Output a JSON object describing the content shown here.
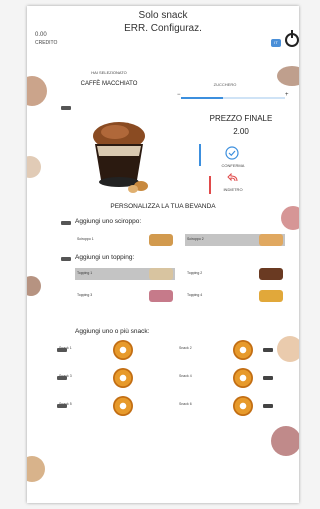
{
  "header": {
    "credit_value": "0.00",
    "credit_label": "CREDITO",
    "title_line1": "Solo snack",
    "title_line2": "ERR. Configuraz.",
    "lang_button": "IT"
  },
  "selection": {
    "label": "HAI SELEZIONATO",
    "product": "CAFFÈ MACCHIATO"
  },
  "sugar": {
    "label": "ZUCCHERO",
    "level": 0.4
  },
  "price": {
    "label": "PREZZO FINALE",
    "value": "2.00"
  },
  "actions": {
    "confirm_label": "CONFERMA",
    "back_label": "INDIETRO"
  },
  "personalize": {
    "title": "PERSONALIZZA LA TUA BEVANDA",
    "syrup_title": "Aggiungi uno sciroppo:",
    "syrups": [
      {
        "label": "Sciroppo 1",
        "selected": false
      },
      {
        "label": "Sciroppo 2",
        "selected": true
      }
    ],
    "topping_title": "Aggiungi un topping:",
    "toppings": [
      {
        "label": "Topping 1",
        "selected": true
      },
      {
        "label": "Topping 2",
        "selected": false
      },
      {
        "label": "Topping 3",
        "selected": false
      },
      {
        "label": "Topping 4",
        "selected": false
      }
    ],
    "snack_title": "Aggiungi uno o più snack:",
    "snacks": [
      {
        "label": "Snack 1"
      },
      {
        "label": "Snack 2"
      },
      {
        "label": "Snack 3"
      },
      {
        "label": "Snack 4"
      },
      {
        "label": "Snack 5"
      },
      {
        "label": "Snack 6"
      }
    ]
  },
  "colors": {
    "accent_blue": "#3c8fde",
    "accent_red": "#e04a4a",
    "selected_bg": "#c4c4c4"
  }
}
